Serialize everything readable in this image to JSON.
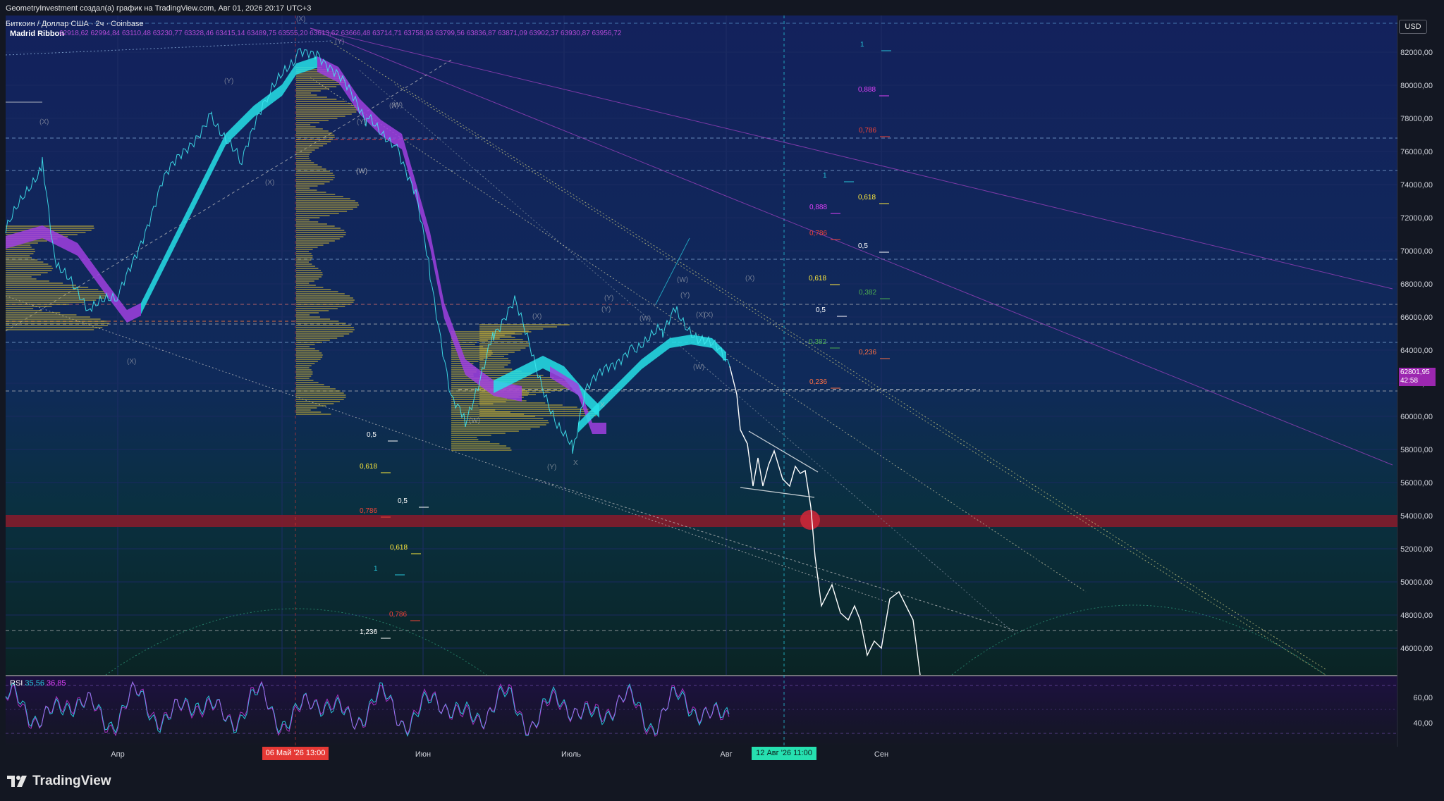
{
  "header": {
    "line1": "GeometryInvestment создал(а) график на TradingView.com, Авг 01, 2026 20:17 UTC+3",
    "symbol_line": "Биткоин / Доллар США · 2ч · Coinbase",
    "indicator_name": "Madrid Ribbon",
    "indicator_values": "62918,62  62994,84  63110,48  63230,77  63328,46  63415,14  63489,75  63555,20  63613,62  63666,48  63714,71  63758,93  63799,56  63836,87  63871,09  63902,37  63930,87  63956,72"
  },
  "price_axis": {
    "currency": "USD",
    "labels": [
      "82000,00",
      "80000,00",
      "78000,00",
      "76000,00",
      "74000,00",
      "72000,00",
      "70000,00",
      "68000,00",
      "66000,00",
      "64000,00",
      "62000,00",
      "60000,00",
      "58000,00",
      "56000,00",
      "54000,00",
      "52000,00",
      "50000,00",
      "48000,00",
      "46000,00"
    ],
    "current_price": "62801,95",
    "countdown": "42:58"
  },
  "rsi": {
    "label": "RSI",
    "value1": "35,56",
    "value2": "36,85",
    "axis_labels": [
      "60,00",
      "40,00"
    ]
  },
  "time_axis": {
    "labels": [
      "Апр",
      "Июн",
      "Июль",
      "Авг",
      "Сен"
    ],
    "highlight_left": "06 Май '26   13:00",
    "highlight_right": "12 Авг '26   11:00"
  },
  "fib_labels": [
    {
      "text": "1",
      "color": "#26c6da"
    },
    {
      "text": "0,888",
      "color": "#e040fb"
    },
    {
      "text": "0,786",
      "color": "#f44336"
    },
    {
      "text": "1",
      "color": "#26c6da"
    },
    {
      "text": "0,618",
      "color": "#ffeb3b"
    },
    {
      "text": "0,888",
      "color": "#e040fb"
    },
    {
      "text": "0,786",
      "color": "#f44336"
    },
    {
      "text": "0,5",
      "color": "#ffffff"
    },
    {
      "text": "0,618",
      "color": "#ffeb3b"
    },
    {
      "text": "0,382",
      "color": "#4caf50"
    },
    {
      "text": "0,5",
      "color": "#ffffff"
    },
    {
      "text": "0,382",
      "color": "#4caf50"
    },
    {
      "text": "0,236",
      "color": "#ff7043"
    },
    {
      "text": "0,236",
      "color": "#ff7043"
    },
    {
      "text": "0,5",
      "color": "#ffffff"
    },
    {
      "text": "0,618",
      "color": "#ffeb3b"
    },
    {
      "text": "0,5",
      "color": "#ffffff"
    },
    {
      "text": "0,786",
      "color": "#f44336"
    },
    {
      "text": "0,618",
      "color": "#ffeb3b"
    },
    {
      "text": "1",
      "color": "#26c6da"
    },
    {
      "text": "0,786",
      "color": "#f44336"
    },
    {
      "text": "1,236",
      "color": "#ffffff"
    }
  ],
  "wave_labels": [
    "(X)",
    "(Y)",
    "(X)",
    "(W)",
    "(Y)",
    "(X)",
    "(W)",
    "(X)",
    "(Y)",
    "(X)",
    "(W)",
    "(X)",
    "(W)",
    "(Y)",
    "(X)",
    "(Y)",
    "(X)",
    "(W)",
    "(Y)",
    "(Y)",
    "X",
    "X",
    "(W)",
    "(X)",
    "(W)"
  ],
  "brand": "TradingView",
  "colors": {
    "background_top": "#12225a",
    "background_bottom": "#0a2a2a",
    "ribbon_up": "#26e0e8",
    "ribbon_down": "#a040e0",
    "volume_profile": "#c9b034",
    "support_zone": "#8b1a2a",
    "price_tag": "#9c27b0",
    "rsi_line": "#26c6da",
    "rsi_signal": "#e040fb",
    "date_left": "#e53935",
    "date_right": "#26e0b0"
  }
}
